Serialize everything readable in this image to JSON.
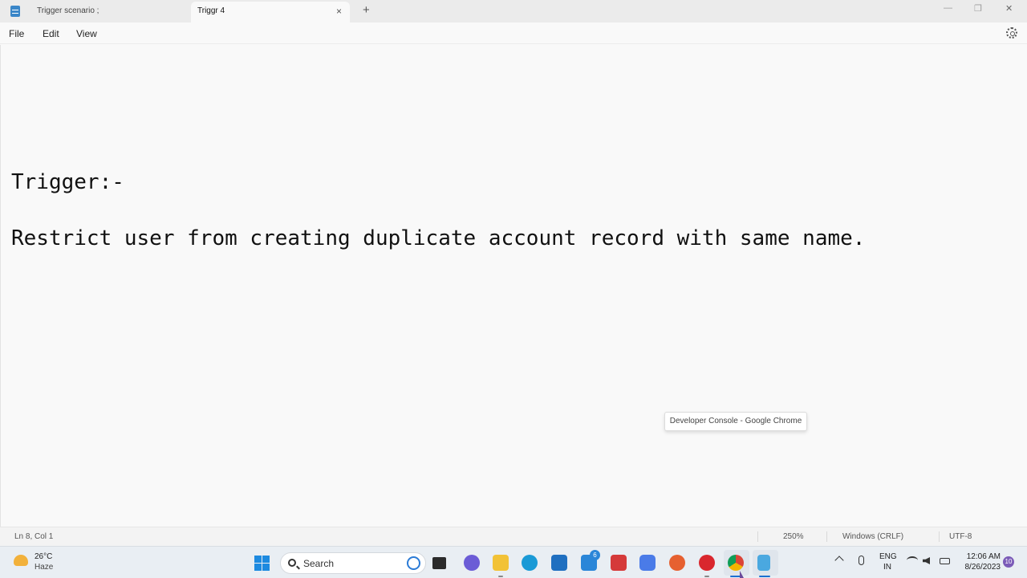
{
  "tabs": [
    {
      "label": "Trigger scenario ;",
      "active": false
    },
    {
      "label": "Triggr 4",
      "active": true
    }
  ],
  "window": {
    "new_tab": "+",
    "close_tab": "×",
    "minimize": "—",
    "maximize": "❐",
    "close": "✕"
  },
  "menu": {
    "file": "File",
    "edit": "Edit",
    "view": "View"
  },
  "editor": {
    "lines": [
      "Trigger:-",
      "Restrict user from creating duplicate account record with same name."
    ]
  },
  "tooltip": "Developer Console - Google Chrome",
  "statusbar": {
    "position": "Ln 8, Col 1",
    "zoom": "250%",
    "line_ending": "Windows (CRLF)",
    "encoding": "UTF-8"
  },
  "taskbar": {
    "weather": {
      "temp": "26°C",
      "desc": "Haze"
    },
    "search_label": "Search",
    "mail_badge": "6",
    "language": {
      "line1": "ENG",
      "line2": "IN"
    },
    "clock": {
      "time": "12:06 AM",
      "date": "8/26/2023"
    },
    "notifications": "10"
  },
  "icons": {
    "app": "notepad-icon",
    "settings": "gear-icon",
    "start": "windows-start-icon",
    "search": "search-icon",
    "bing": "bing-icon",
    "chrome": "chrome-icon"
  },
  "colors": {
    "accent": "#1d8ae0",
    "editor_bg": "#f9f9f9",
    "taskbar_bg": "#e9eef3"
  }
}
